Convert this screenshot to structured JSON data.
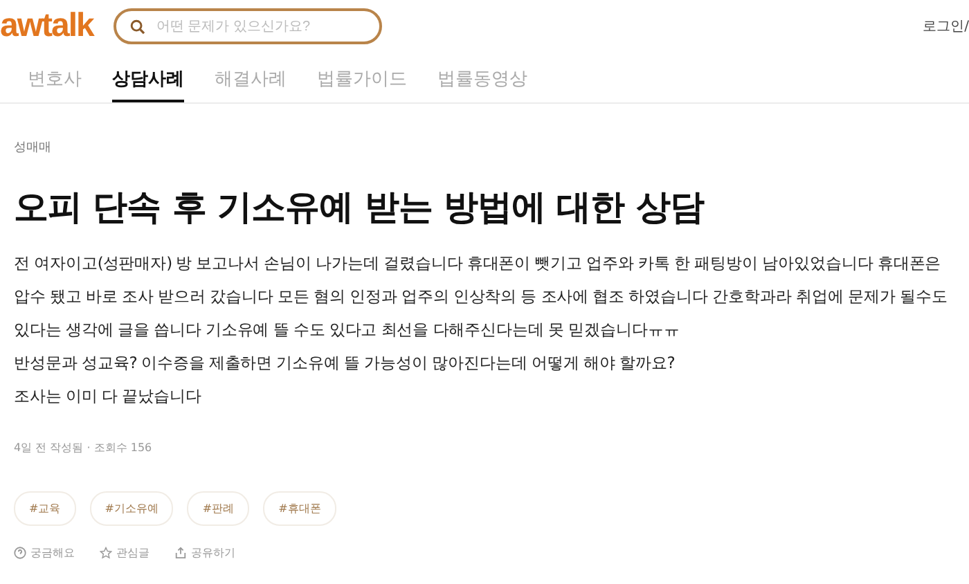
{
  "header": {
    "logo": "awtalk",
    "search": {
      "placeholder": "어떤 문제가 있으신가요?"
    },
    "login": "로그인/"
  },
  "tabs": [
    {
      "label": "변호사",
      "selected": false
    },
    {
      "label": "상담사례",
      "selected": true
    },
    {
      "label": "해결사례",
      "selected": false
    },
    {
      "label": "법률가이드",
      "selected": false
    },
    {
      "label": "법률동영상",
      "selected": false
    }
  ],
  "post": {
    "category": "성매매",
    "title": "오피 단속 후 기소유예 받는 방법에 대한 상담",
    "paragraphs": [
      "전 여자이고(성판매자) 방 보고나서 손님이 나가는데 걸렸습니다 휴대폰이 뺏기고 업주와 카톡 한 패팅방이 남아있었습니다 휴대폰은 압수 됐고 바로 조사 받으러 갔습니다 모든 혐의 인정과 업주의 인상착의 등 조사에 협조 하였습니다 간호학과라 취업에 문제가 될수도 있다는 생각에 글을 씁니다 기소유예 뜰 수도 있다고 최선을 다해주신다는데 못 믿겠습니다ㅠㅠ",
      "반성문과 성교육? 이수증을 제출하면 기소유예 뜰 가능성이 많아진다는데 어떻게 해야 할까요?",
      "조사는 이미 다 끝났습니다"
    ],
    "meta": "4일 전 작성됨 · 조회수 156",
    "tags": [
      "#교육",
      "#기소유예",
      "#판례",
      "#휴대폰"
    ],
    "actions": [
      {
        "kind": "curious",
        "label": "궁금해요"
      },
      {
        "kind": "star",
        "label": "관심글"
      },
      {
        "kind": "share",
        "label": "공유하기"
      }
    ]
  }
}
